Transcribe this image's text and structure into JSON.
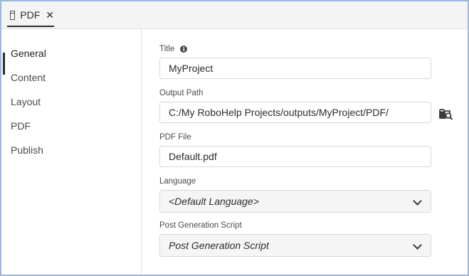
{
  "tab": {
    "label": "PDF",
    "close": "✕"
  },
  "sidebar": {
    "items": [
      {
        "label": "General",
        "active": true
      },
      {
        "label": "Content"
      },
      {
        "label": "Layout"
      },
      {
        "label": "PDF"
      },
      {
        "label": "Publish"
      }
    ]
  },
  "form": {
    "title_label": "Title",
    "title_value": "MyProject",
    "output_path_label": "Output Path",
    "output_path_value": "C:/My RoboHelp Projects/outputs/MyProject/PDF/",
    "pdf_file_label": "PDF File",
    "pdf_file_value": "Default.pdf",
    "language_label": "Language",
    "language_value": "<Default Language>",
    "script_label": "Post Generation Script",
    "script_value": "Post Generation Script"
  },
  "icons": {
    "tab": "window-icon",
    "close": "close-icon",
    "info": "info-icon",
    "browse": "folder-search-icon",
    "dropdown": "chevron-down-icon"
  }
}
